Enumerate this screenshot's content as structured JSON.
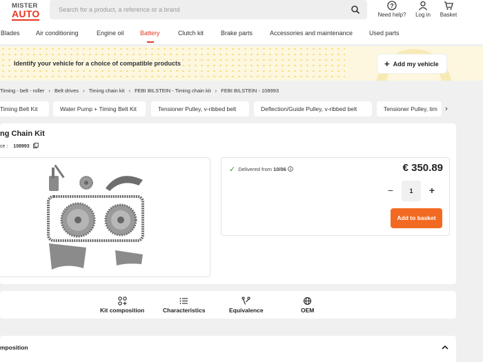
{
  "header": {
    "logo_line1": "MISTER",
    "logo_line2": "AUTO",
    "search_placeholder": "Search for a product, a reference or a brand",
    "actions": {
      "help": "Need help?",
      "login": "Log in",
      "basket": "Basket"
    }
  },
  "nav": {
    "items": [
      "Blades",
      "Air conditioning",
      "Engine oil",
      "Battery",
      "Clutch kit",
      "Brake parts",
      "Accessories and maintenance",
      "Used parts"
    ],
    "active": "Battery"
  },
  "banner": {
    "text": "Identify your vehicle for a choice of compatible products",
    "button": "Add my vehicle"
  },
  "breadcrumb": [
    "Timing - belt - roller",
    "›",
    "Belt drives",
    "›",
    "Timing chain kit",
    "›",
    "FEBI BILSTEIN - Timing chain kit",
    "›",
    "FEBI BILSTEIN - 108993"
  ],
  "chips": [
    "Timing Belt Kit",
    "Water Pump + Timing Belt Kit",
    "Tensioner Pulley, v-ribbed belt",
    "Deflection/Guide Pulley, v-ribbed belt",
    "Tensioner Pulley, tim"
  ],
  "product": {
    "title": "ng Chain Kit",
    "ref_label": "ce :",
    "ref_value": "108993",
    "delivery_prefix": "Delivered from",
    "delivery_date": "10/06",
    "price": "€ 350.89",
    "quantity": "1",
    "add_button": "Add to basket"
  },
  "tabs": [
    "Kit composition",
    "Characteristics",
    "Equivalence",
    "OEM"
  ],
  "composition": {
    "title": "mposition"
  },
  "colors": {
    "brand": "#e8351e",
    "cta": "#f26a22",
    "banner_bg": "#fdf7df",
    "check": "#2a9d3a"
  }
}
